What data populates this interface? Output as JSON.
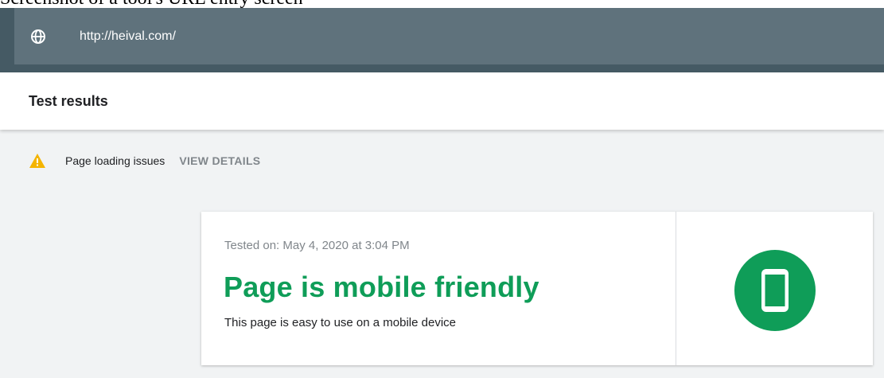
{
  "window": {
    "partial_caption": "Screenshot of a tool's URL entry screen"
  },
  "url_bar": {
    "icon": "globe-icon",
    "url": "http://heival.com/"
  },
  "results": {
    "title": "Test results"
  },
  "issues": {
    "icon": "warning-icon",
    "label": "Page loading issues",
    "action": "VIEW DETAILS"
  },
  "card": {
    "tested_on": "Tested on: May 4, 2020 at 3:04 PM",
    "headline": "Page is mobile friendly",
    "description": "This page is easy to use on a mobile device",
    "badge_icon": "mobile-phone-icon"
  },
  "colors": {
    "success": "#0f9d58",
    "warning": "#f4b400",
    "url_bar": "#455a64"
  }
}
